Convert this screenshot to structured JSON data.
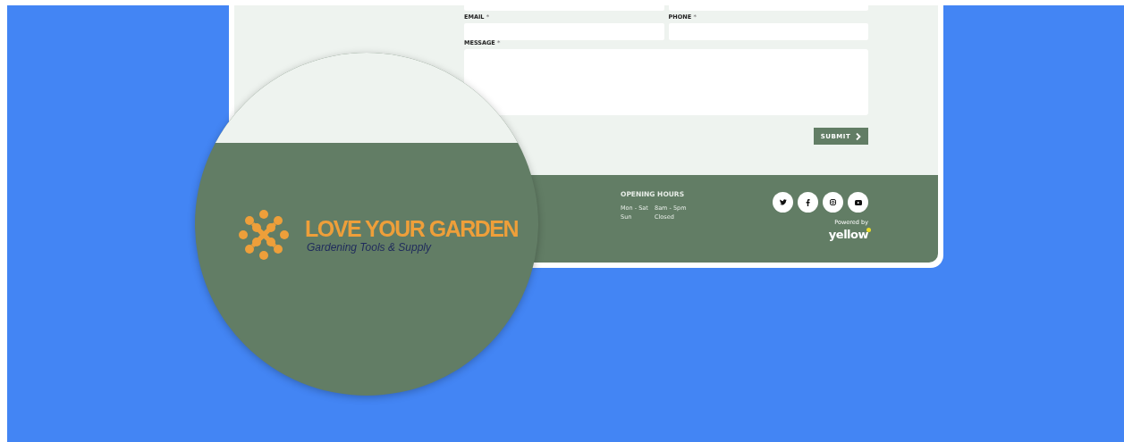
{
  "form": {
    "fields": [
      {
        "label": "EMAIL",
        "required_mark": "*"
      },
      {
        "label": "PHONE",
        "required_mark": "*"
      }
    ],
    "message": {
      "label": "MESSAGE",
      "required_mark": "*"
    },
    "submit": {
      "label": "SUBMIT"
    }
  },
  "footer": {
    "hours_title": "OPENING HOURS",
    "hours": [
      {
        "days": "Mon - Sat",
        "time": "8am - 5pm"
      },
      {
        "days": "Sun",
        "time": "Closed"
      }
    ],
    "social": [
      {
        "kind": "twitter"
      },
      {
        "kind": "facebook"
      },
      {
        "kind": "instagram"
      },
      {
        "kind": "youtube"
      }
    ],
    "powered_by": "Powered by",
    "brand": "yellow"
  },
  "magnifier": {
    "logo_title": "LOVE YOUR GARDEN",
    "logo_tagline": "Gardening Tools & Supply"
  }
}
